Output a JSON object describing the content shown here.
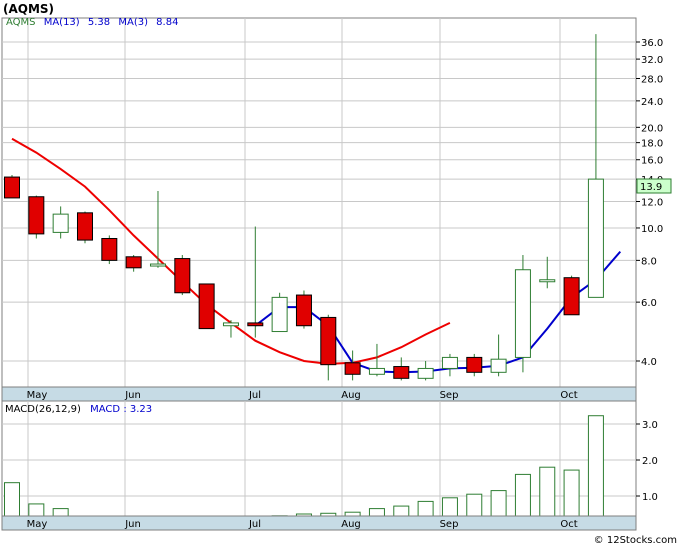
{
  "chart_data": [
    {
      "type": "candlestick",
      "title": "(AQMS)",
      "legend": [
        {
          "label": "AQMS",
          "color": "#2e7d32"
        },
        {
          "label": "MA(13)",
          "value": "5.38",
          "color": "#cc0000"
        },
        {
          "label": "MA(3)",
          "value": "8.84",
          "color": "#0000cc"
        }
      ],
      "scale": "log",
      "ylim": [
        3.5,
        41
      ],
      "y_ticks": [
        "36.0",
        "32.0",
        "28.0",
        "24.0",
        "20.0",
        "18.0",
        "16.0",
        "14.0",
        "12.0",
        "10.0",
        "8.0",
        "6.0",
        "4.0"
      ],
      "last_price": "13.9",
      "x_labels": [
        "May",
        "Jun",
        "Jul",
        "Aug",
        "Sep",
        "Oct"
      ],
      "candles": [
        {
          "o": 14.2,
          "h": 14.4,
          "l": 12.3,
          "c": 12.3
        },
        {
          "o": 12.4,
          "h": 12.5,
          "l": 9.3,
          "c": 9.6
        },
        {
          "o": 9.7,
          "h": 11.6,
          "l": 9.3,
          "c": 11.0
        },
        {
          "o": 11.1,
          "h": 11.2,
          "l": 9.0,
          "c": 9.2
        },
        {
          "o": 9.3,
          "h": 9.5,
          "l": 7.8,
          "c": 8.0
        },
        {
          "o": 8.2,
          "h": 8.3,
          "l": 7.4,
          "c": 7.6
        },
        {
          "o": 7.7,
          "h": 12.9,
          "l": 7.6,
          "c": 7.8
        },
        {
          "o": 8.1,
          "h": 8.3,
          "l": 6.3,
          "c": 6.4
        },
        {
          "o": 6.8,
          "h": 6.8,
          "l": 5.0,
          "c": 5.0
        },
        {
          "o": 5.1,
          "h": 5.3,
          "l": 4.7,
          "c": 5.2
        },
        {
          "o": 5.2,
          "h": 10.1,
          "l": 4.7,
          "c": 5.1
        },
        {
          "o": 4.9,
          "h": 6.4,
          "l": 4.9,
          "c": 6.2
        },
        {
          "o": 6.3,
          "h": 6.5,
          "l": 5.0,
          "c": 5.1
        },
        {
          "o": 5.4,
          "h": 5.5,
          "l": 3.5,
          "c": 3.9
        },
        {
          "o": 3.95,
          "h": 4.3,
          "l": 3.5,
          "c": 3.65
        },
        {
          "o": 3.65,
          "h": 4.5,
          "l": 3.6,
          "c": 3.8
        },
        {
          "o": 3.85,
          "h": 4.1,
          "l": 3.5,
          "c": 3.55
        },
        {
          "o": 3.55,
          "h": 4.0,
          "l": 3.5,
          "c": 3.8
        },
        {
          "o": 3.8,
          "h": 4.2,
          "l": 3.6,
          "c": 4.1
        },
        {
          "o": 4.1,
          "h": 4.2,
          "l": 3.6,
          "c": 3.7
        },
        {
          "o": 3.7,
          "h": 4.8,
          "l": 3.6,
          "c": 4.05
        },
        {
          "o": 4.1,
          "h": 8.3,
          "l": 3.7,
          "c": 7.5
        },
        {
          "o": 7.0,
          "h": 8.2,
          "l": 6.6,
          "c": 7.0
        },
        {
          "o": 7.1,
          "h": 7.2,
          "l": 5.5,
          "c": 5.5
        },
        {
          "o": 6.2,
          "h": 38.0,
          "l": 6.2,
          "c": 14.0
        }
      ],
      "ma13": [
        18.5,
        16.8,
        15.0,
        13.3,
        11.3,
        9.5,
        8.1,
        6.9,
        5.9,
        5.2,
        4.6,
        4.25,
        4.0,
        3.92,
        3.95,
        4.1,
        4.4,
        4.8,
        5.2
      ],
      "ma3": [
        5.1,
        5.8,
        5.8,
        5.1,
        3.95,
        3.72,
        3.7,
        3.72,
        3.8,
        3.82,
        3.87,
        4.1,
        5.0,
        6.2,
        7.0,
        8.5
      ]
    },
    {
      "type": "bar",
      "title": "MACD(26,12,9)",
      "legend": [
        {
          "label": "MACD",
          "value": "3.23",
          "color": "#0000cc"
        }
      ],
      "ylim": [
        0,
        3.6
      ],
      "y_ticks": [
        "3.0",
        "2.0",
        "1.0"
      ],
      "x_labels": [
        "May",
        "Jun",
        "Jul",
        "Aug",
        "Sep",
        "Oct"
      ],
      "values": [
        1.37,
        0.78,
        0.65,
        0.4,
        0.18,
        0.1,
        0.15,
        0.1,
        0.0,
        0.05,
        0.15,
        0.45,
        0.5,
        0.52,
        0.55,
        0.65,
        0.72,
        0.85,
        0.95,
        1.05,
        1.15,
        1.6,
        1.8,
        1.72,
        3.23
      ]
    }
  ],
  "watermark": "© 12Stocks.com",
  "colors": {
    "up": "#ffffff",
    "down": "#e00000",
    "wick": "#2e7d32",
    "ma13": "#ee0000",
    "ma3": "#0000cc",
    "macd_fill": "#ffffff",
    "macd_stroke": "#2e7d32",
    "panel_bg": "#ffffff",
    "axis_band": "#c6dbe5",
    "last_price_bg": "#ccffcc",
    "grid": "#c8c8c8"
  }
}
